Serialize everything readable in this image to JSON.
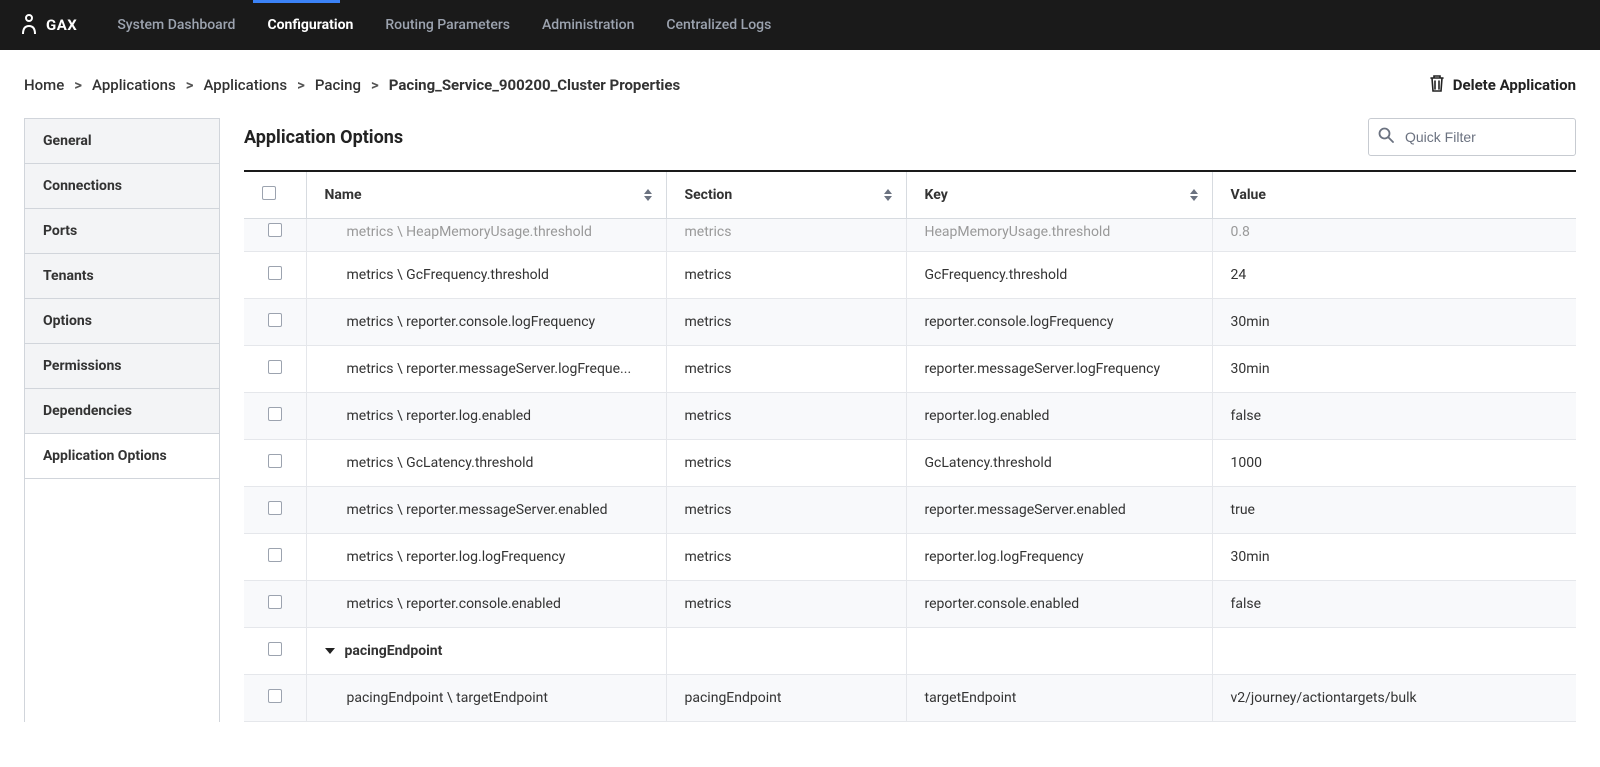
{
  "app": {
    "logo_text": "GAX"
  },
  "nav": [
    {
      "label": "System Dashboard",
      "active": false
    },
    {
      "label": "Configuration",
      "active": true
    },
    {
      "label": "Routing Parameters",
      "active": false
    },
    {
      "label": "Administration",
      "active": false
    },
    {
      "label": "Centralized Logs",
      "active": false
    }
  ],
  "breadcrumb": [
    {
      "label": "Home"
    },
    {
      "label": "Applications"
    },
    {
      "label": "Applications"
    },
    {
      "label": "Pacing"
    },
    {
      "label": "Pacing_Service_900200_Cluster Properties"
    }
  ],
  "delete_label": "Delete Application",
  "sidebar": [
    {
      "label": "General",
      "active": false
    },
    {
      "label": "Connections",
      "active": false
    },
    {
      "label": "Ports",
      "active": false
    },
    {
      "label": "Tenants",
      "active": false
    },
    {
      "label": "Options",
      "active": false
    },
    {
      "label": "Permissions",
      "active": false
    },
    {
      "label": "Dependencies",
      "active": false
    },
    {
      "label": "Application Options",
      "active": true
    }
  ],
  "content": {
    "title": "Application Options",
    "filter_placeholder": "Quick Filter",
    "columns": {
      "name": "Name",
      "section": "Section",
      "key": "Key",
      "value": "Value"
    },
    "rows": [
      {
        "type": "clipped",
        "name": "metrics \\ HeapMemoryUsage.threshold",
        "section": "metrics",
        "key": "HeapMemoryUsage.threshold",
        "value": "0.8"
      },
      {
        "type": "row",
        "name": "metrics \\ GcFrequency.threshold",
        "section": "metrics",
        "key": "GcFrequency.threshold",
        "value": "24"
      },
      {
        "type": "row",
        "name": "metrics \\ reporter.console.logFrequency",
        "section": "metrics",
        "key": "reporter.console.logFrequency",
        "value": "30min"
      },
      {
        "type": "row",
        "name": "metrics \\ reporter.messageServer.logFreque...",
        "section": "metrics",
        "key": "reporter.messageServer.logFrequency",
        "value": "30min"
      },
      {
        "type": "row",
        "name": "metrics \\ reporter.log.enabled",
        "section": "metrics",
        "key": "reporter.log.enabled",
        "value": "false"
      },
      {
        "type": "row",
        "name": "metrics \\ GcLatency.threshold",
        "section": "metrics",
        "key": "GcLatency.threshold",
        "value": "1000"
      },
      {
        "type": "row",
        "name": "metrics \\ reporter.messageServer.enabled",
        "section": "metrics",
        "key": "reporter.messageServer.enabled",
        "value": "true"
      },
      {
        "type": "row",
        "name": "metrics \\ reporter.log.logFrequency",
        "section": "metrics",
        "key": "reporter.log.logFrequency",
        "value": "30min"
      },
      {
        "type": "row",
        "name": "metrics \\ reporter.console.enabled",
        "section": "metrics",
        "key": "reporter.console.enabled",
        "value": "false"
      },
      {
        "type": "group",
        "name": "pacingEndpoint",
        "section": "",
        "key": "",
        "value": ""
      },
      {
        "type": "row",
        "name": "pacingEndpoint \\ targetEndpoint",
        "section": "pacingEndpoint",
        "key": "targetEndpoint",
        "value": "v2/journey/actiontargets/bulk"
      }
    ]
  }
}
